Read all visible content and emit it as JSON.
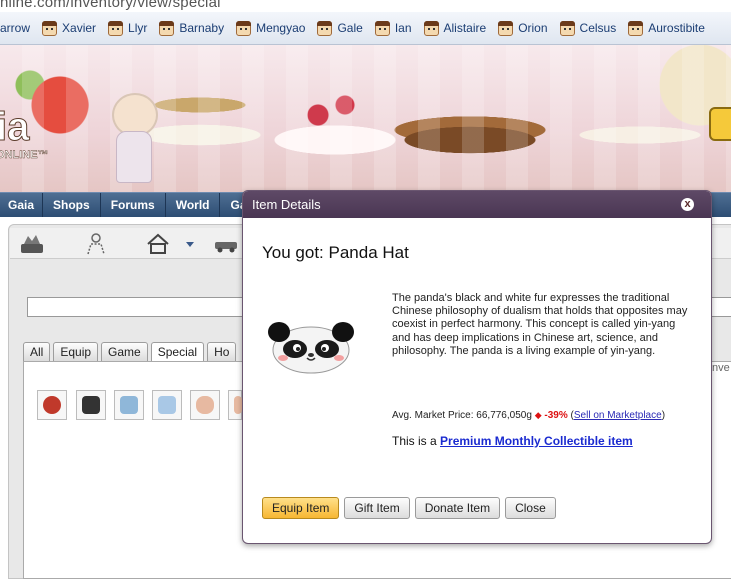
{
  "browser": {
    "url_fragment": "nline.com/inventory/view/special",
    "bookmarks": [
      "arrow",
      "Xavier",
      "Llyr",
      "Barnaby",
      "Mengyao",
      "Gale",
      "Ian",
      "Alistaire",
      "Orion",
      "Celsus",
      "Aurostibite"
    ]
  },
  "banner": {
    "logo_main": "ia",
    "logo_sub": "ONLINE™"
  },
  "main_nav": [
    "Gaia",
    "Shops",
    "Forums",
    "World",
    "Ga"
  ],
  "inventory": {
    "tabs": [
      "All",
      "Equip",
      "Game",
      "Special",
      "Ho"
    ],
    "active_tab": "Special",
    "side_label": "Inve"
  },
  "modal": {
    "title": "Item Details",
    "close_label": "x",
    "got_text": "You got: Panda Hat",
    "description": "The panda's black and white fur expresses the traditional Chinese philosophy of dualism that holds that opposites may coexist in perfect harmony. This concept is called yin-yang and has deep implications in Chinese art, science, and philosophy. The panda is a living example of yin-yang.",
    "market_prefix": "Avg. Market Price: 66,776,050g",
    "market_change": "-39%",
    "market_link": "Sell on Marketplace",
    "premium_prefix": "This is a",
    "premium_link": "Premium Monthly Collectible item",
    "buttons": {
      "equip": "Equip Item",
      "gift": "Gift Item",
      "donate": "Donate Item",
      "close": "Close"
    }
  },
  "colors": {
    "modal_header": "#4a3653",
    "nav": "#2d4d73",
    "primary_button": "#f7b733",
    "price_drop": "#dd1111"
  }
}
